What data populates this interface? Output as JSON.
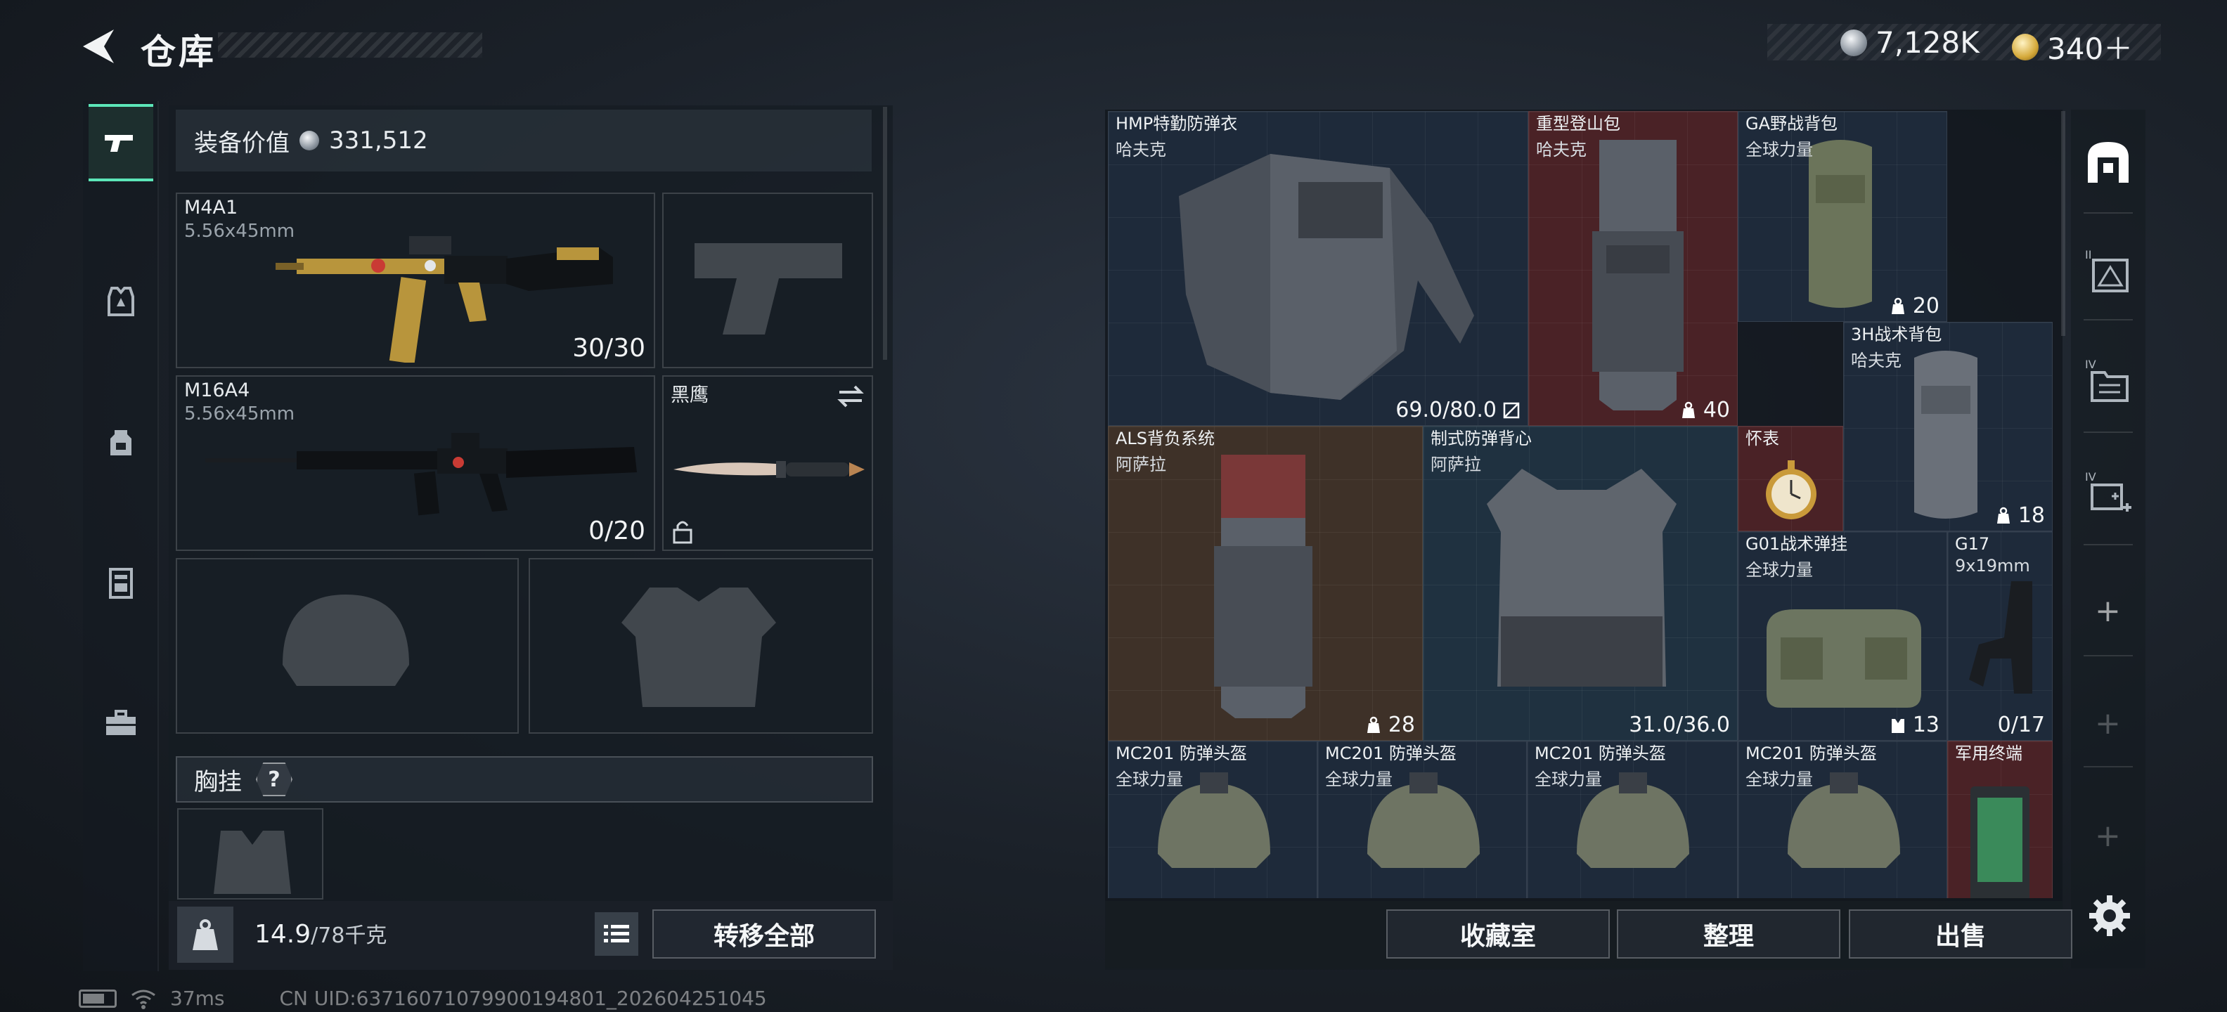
{
  "header": {
    "title": "仓库",
    "currencies": [
      {
        "icon": "silver-coin-icon",
        "value": "7,128K"
      },
      {
        "icon": "gold-coin-icon",
        "value": "340＋"
      }
    ]
  },
  "left_tabs": [
    {
      "icon": "pistol-icon",
      "active": true
    },
    {
      "icon": "armor-vest-icon",
      "active": false
    },
    {
      "icon": "backpack-icon",
      "active": false
    },
    {
      "icon": "rig-icon",
      "active": false
    },
    {
      "icon": "toolbox-icon",
      "active": false
    }
  ],
  "loadout": {
    "value_label": "装备价值",
    "value": "331,512",
    "primary_weapon": {
      "name": "M4A1",
      "caliber": "5.56x45mm",
      "ammo": "30/30"
    },
    "secondary_weapon": {
      "name": "M16A4",
      "caliber": "5.56x45mm",
      "ammo": "0/20"
    },
    "melee": {
      "name": "黑鹰"
    },
    "chest_rig_label": "胸挂",
    "help_label": "?",
    "weight": "14.9",
    "weight_capacity": "/78千克",
    "transfer_all": "转移全部"
  },
  "stash_items": [
    {
      "name": "HMP特勤防弹衣",
      "brand": "哈夫克",
      "value": "69.0/80.0"
    },
    {
      "name": "重型登山包",
      "brand": "哈夫克",
      "value": "40"
    },
    {
      "name": "GA野战背包",
      "brand": "全球力量",
      "value": "20"
    },
    {
      "name": "3H战术背包",
      "brand": "哈夫克",
      "value": "18"
    },
    {
      "name": "ALS背负系统",
      "brand": "阿萨拉",
      "value": "28"
    },
    {
      "name": "制式防弹背心",
      "brand": "阿萨拉",
      "value": "31.0/36.0"
    },
    {
      "name": "怀表",
      "brand": "",
      "value": ""
    },
    {
      "name": "G01战术弹挂",
      "brand": "全球力量",
      "value": "13"
    },
    {
      "name": "G17",
      "brand": "9x19mm",
      "value": "0/17"
    },
    {
      "name": "MC201 防弹头盔",
      "brand": "全球力量",
      "value": ""
    },
    {
      "name": "MC201 防弹头盔",
      "brand": "全球力量",
      "value": ""
    },
    {
      "name": "MC201 防弹头盔",
      "brand": "全球力量",
      "value": ""
    },
    {
      "name": "MC201 防弹头盔",
      "brand": "全球力量",
      "value": ""
    },
    {
      "name": "军用终端",
      "brand": "",
      "value": ""
    }
  ],
  "right_tabs": [
    {
      "icon": "stash-icon",
      "label": ""
    },
    {
      "icon": "container-ii-icon",
      "label": "II"
    },
    {
      "icon": "container-iv-icon",
      "label": "IV"
    },
    {
      "icon": "container-iv-add-icon",
      "label": "IV"
    }
  ],
  "actions": {
    "collection": "收藏室",
    "organize": "整理",
    "sell": "出售"
  },
  "status_bar": {
    "ping": "37ms",
    "uid": "CN UID:6371607107990019480​1_202604251045"
  },
  "colors": {
    "accent": "#5ce6b8",
    "cell_blue": "#1e2a3a",
    "cell_red": "#4a2226",
    "cell_brown": "#3e3128"
  }
}
